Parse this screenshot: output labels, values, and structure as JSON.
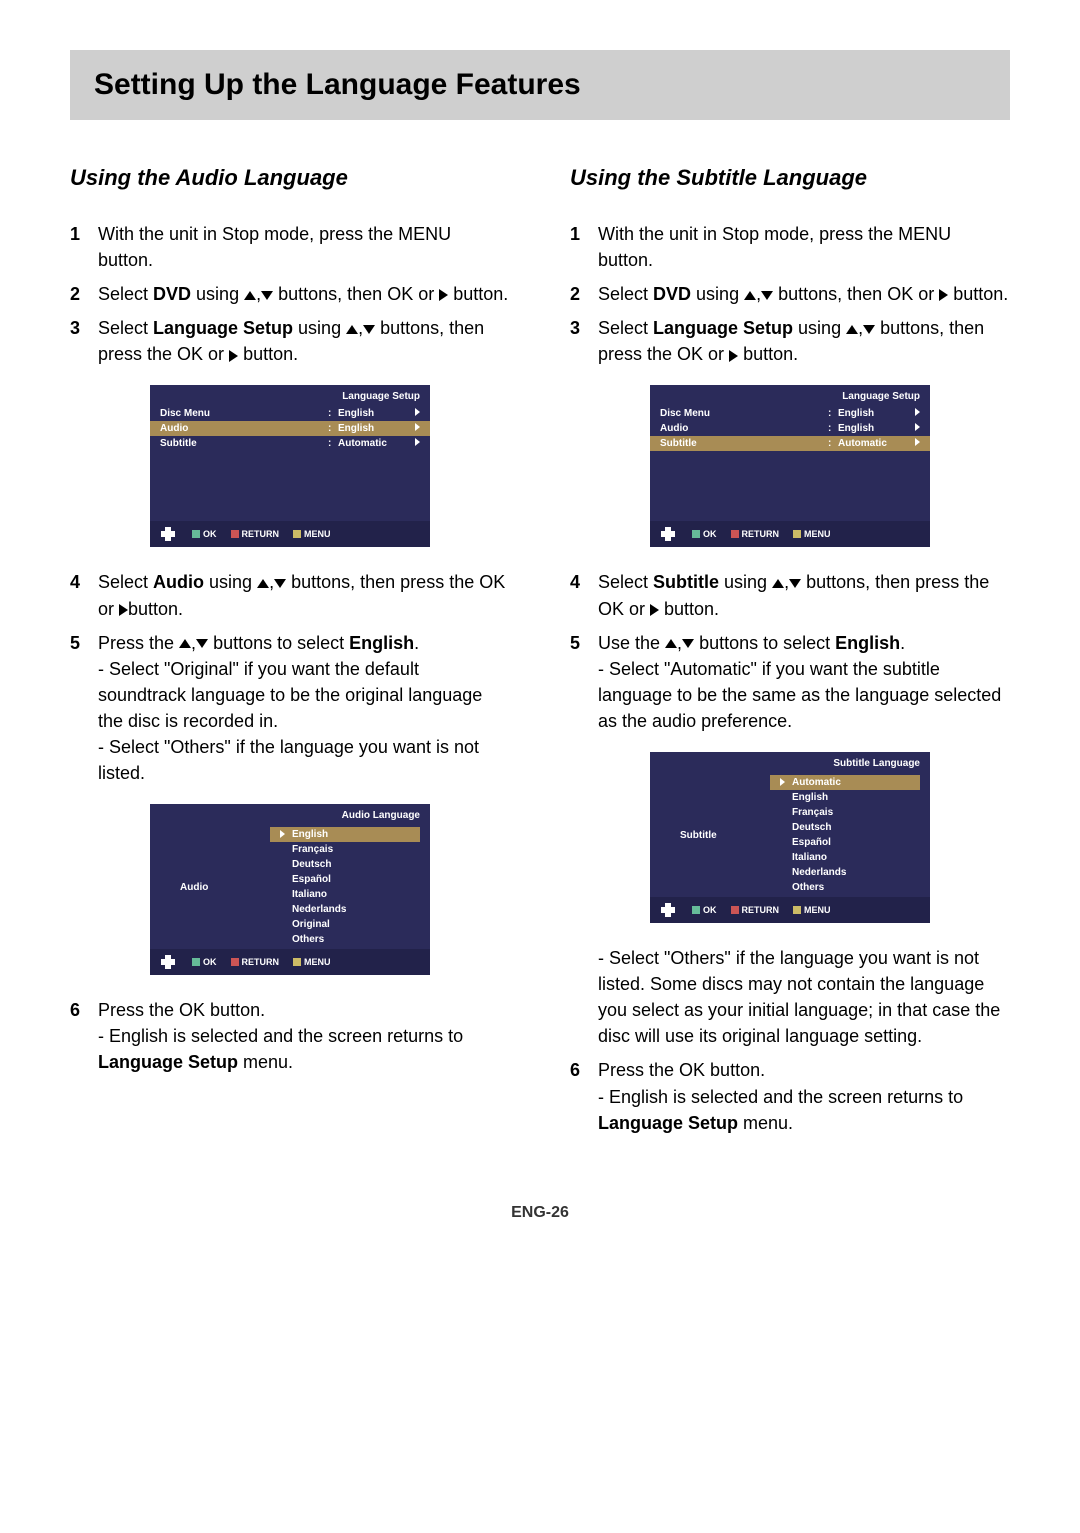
{
  "title": "Setting Up the Language Features",
  "page_number": "ENG-26",
  "btn": {
    "up": "▲",
    "down": "▼",
    "right": "▶"
  },
  "audio": {
    "heading": "Using the Audio Language",
    "s1": "With the unit in Stop mode, press the MENU button.",
    "s2a": "Select ",
    "s2b": "DVD",
    "s2c": " using ",
    "s2d": " buttons, then OK or ",
    "s2e": " button.",
    "s3a": "Select ",
    "s3b": "Language Setup",
    "s3c": " using ",
    "s3d": " buttons, then press the OK or ",
    "s3e": " button.",
    "s4a": "Select ",
    "s4b": "Audio",
    "s4c": " using ",
    "s4d": " buttons, then press the OK or ",
    "s4e": "button.",
    "s5a": "Press the ",
    "s5b": " buttons to select ",
    "s5c": "English",
    "s5d": ".",
    "s5x": "- Select \"Original\" if you want the default soundtrack language to be the original language the disc is recorded in.",
    "s5y": "- Select \"Others\" if the language you want is not listed.",
    "s6a": "Press the OK button.",
    "s6b": "- English is selected and the screen returns to ",
    "s6c": "Language Setup",
    "s6d": " menu."
  },
  "subtitle": {
    "heading": "Using the Subtitle Language",
    "s1": "With the unit in Stop mode, press the MENU button.",
    "s2a": "Select ",
    "s2b": "DVD",
    "s2c": " using ",
    "s2d": " buttons, then OK or ",
    "s2e": " button.",
    "s3a": "Select ",
    "s3b": "Language Setup",
    "s3c": " using ",
    "s3d": " buttons, then press the OK or ",
    "s3e": " button.",
    "s4a": "Select ",
    "s4b": "Subtitle",
    "s4c": " using ",
    "s4d": " buttons, then press the OK or ",
    "s4e": " button.",
    "s5a": "Use the ",
    "s5b": " buttons to select ",
    "s5c": "English",
    "s5d": ".",
    "s5x": "- Select \"Automatic\" if you want the subtitle language to be the same as the language selected as the audio preference.",
    "s5y": "- Select \"Others\" if the language you want is not listed. Some discs may not contain the language you select as your initial language; in that case the disc will use its original language setting.",
    "s6a": "Press the OK button.",
    "s6b": "- English is selected and the screen returns to ",
    "s6c": "Language Setup",
    "s6d": " menu."
  },
  "osd1": {
    "title": "Language Setup",
    "rows": [
      {
        "l": "Disc Menu",
        "r": "English",
        "hi": false
      },
      {
        "l": "Audio",
        "r": "English",
        "hi": true
      },
      {
        "l": "Subtitle",
        "r": "Automatic",
        "hi": false
      }
    ]
  },
  "osd2": {
    "title": "Audio Language",
    "side": "Audio",
    "items": [
      "English",
      "Français",
      "Deutsch",
      "Español",
      "Italiano",
      "Nederlands",
      "Original",
      "Others"
    ],
    "hi": 0
  },
  "osd3": {
    "title": "Language Setup",
    "rows": [
      {
        "l": "Disc Menu",
        "r": "English",
        "hi": false
      },
      {
        "l": "Audio",
        "r": "English",
        "hi": false
      },
      {
        "l": "Subtitle",
        "r": "Automatic",
        "hi": true
      }
    ]
  },
  "osd4": {
    "title": "Subtitle Language",
    "side": "Subtitle",
    "items": [
      "Automatic",
      "English",
      "Français",
      "Deutsch",
      "Español",
      "Italiano",
      "Nederlands",
      "Others"
    ],
    "hi": 0
  },
  "foot": {
    "ok": "OK",
    "return": "RETURN",
    "menu": "MENU"
  }
}
